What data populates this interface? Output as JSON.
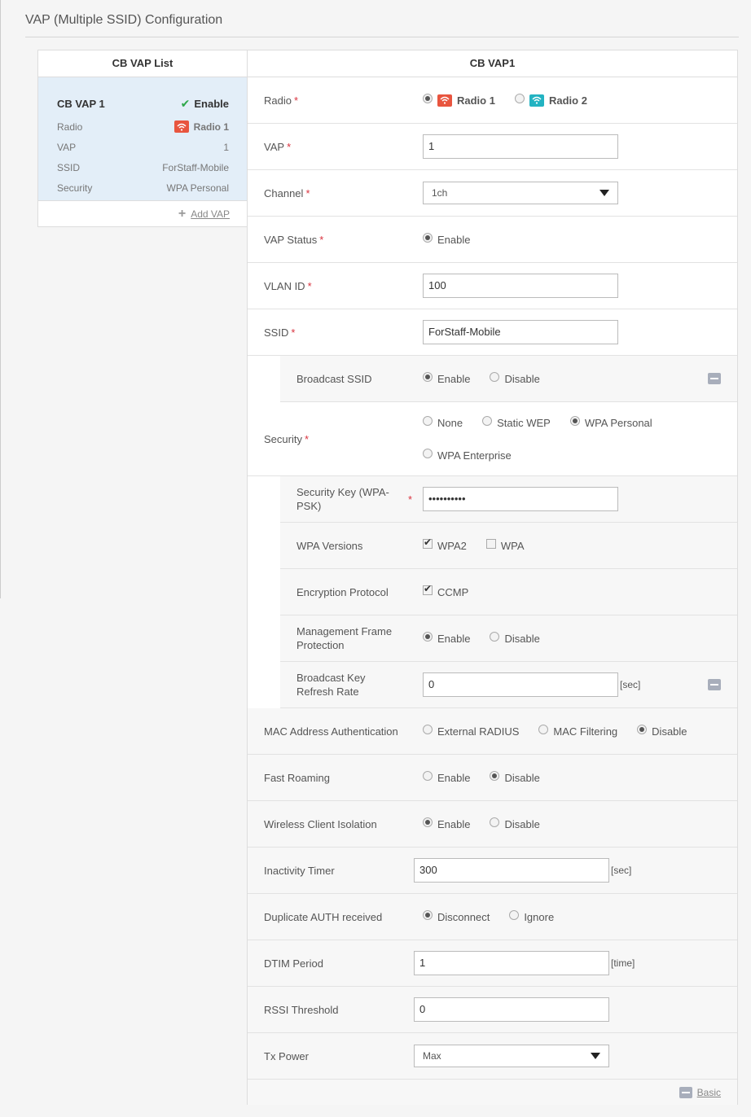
{
  "page": {
    "title": "VAP (Multiple SSID) Configuration"
  },
  "vap_list": {
    "header": "CB VAP List",
    "card": {
      "name": "CB VAP 1",
      "status": "Enable",
      "rows": [
        {
          "label": "Radio",
          "value": "Radio 1"
        },
        {
          "label": "VAP",
          "value": "1"
        },
        {
          "label": "SSID",
          "value": "ForStaff-Mobile"
        },
        {
          "label": "Security",
          "value": "WPA Personal"
        }
      ]
    },
    "add_label": "Add VAP"
  },
  "detail": {
    "header": "CB VAP1",
    "radio": {
      "label": "Radio",
      "options": [
        "Radio 1",
        "Radio 2"
      ],
      "selected": "Radio 1"
    },
    "vap": {
      "label": "VAP",
      "value": "1"
    },
    "channel": {
      "label": "Channel",
      "value": "1ch"
    },
    "vap_status": {
      "label": "VAP Status",
      "option": "Enable"
    },
    "vlan_id": {
      "label": "VLAN ID",
      "value": "100"
    },
    "ssid": {
      "label": "SSID",
      "value": "ForStaff-Mobile"
    },
    "broadcast_ssid": {
      "label": "Broadcast SSID",
      "options": [
        "Enable",
        "Disable"
      ],
      "selected": "Enable"
    },
    "security": {
      "label": "Security",
      "options": [
        "None",
        "Static WEP",
        "WPA Personal",
        "WPA Enterprise"
      ],
      "selected": "WPA Personal"
    },
    "security_key": {
      "label": "Security Key (WPA-PSK)",
      "value": "••••••••••"
    },
    "wpa_versions": {
      "label": "WPA Versions",
      "options": [
        "WPA2",
        "WPA"
      ],
      "checked": [
        "WPA2"
      ]
    },
    "encryption": {
      "label": "Encryption Protocol",
      "option": "CCMP"
    },
    "mgmt_frame": {
      "label": "Management Frame Protection",
      "options": [
        "Enable",
        "Disable"
      ],
      "selected": "Enable"
    },
    "bcast_key_refresh": {
      "label": "Broadcast Key Refresh Rate",
      "value": "0",
      "unit": "[sec]"
    },
    "mac_auth": {
      "label": "MAC Address Authentication",
      "options": [
        "External RADIUS",
        "MAC Filtering",
        "Disable"
      ],
      "selected": "Disable"
    },
    "fast_roaming": {
      "label": "Fast Roaming",
      "options": [
        "Enable",
        "Disable"
      ],
      "selected": "Disable"
    },
    "client_isolation": {
      "label": "Wireless Client Isolation",
      "options": [
        "Enable",
        "Disable"
      ],
      "selected": "Enable"
    },
    "inactivity_timer": {
      "label": "Inactivity Timer",
      "value": "300",
      "unit": "[sec]"
    },
    "dup_auth": {
      "label": "Duplicate AUTH received",
      "options": [
        "Disconnect",
        "Ignore"
      ],
      "selected": "Disconnect"
    },
    "dtim": {
      "label": "DTIM Period",
      "value": "1",
      "unit": "[time]"
    },
    "rssi": {
      "label": "RSSI Threshold",
      "value": "0"
    },
    "tx_power": {
      "label": "Tx Power",
      "value": "Max"
    },
    "basic_label": "Basic"
  },
  "required_mark": "*",
  "colors": {
    "radio1": "#e8553f",
    "radio2": "#23b3c2",
    "selected_bg": "#e3eef8",
    "required": "#d9333f"
  }
}
